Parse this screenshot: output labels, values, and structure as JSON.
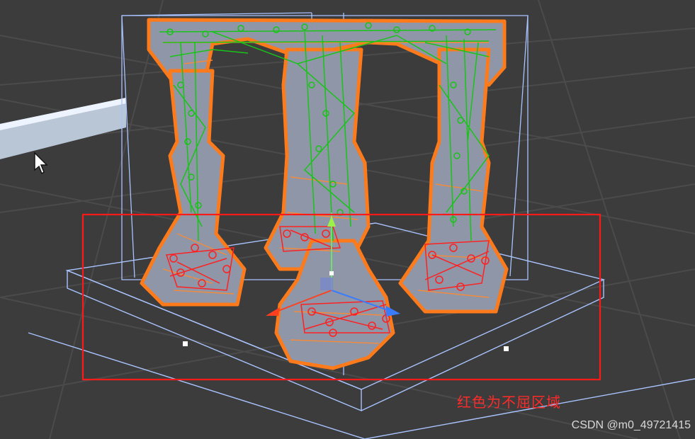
{
  "viewport": {
    "annotation_text": "红色为不屈区域",
    "watermark_text": "CSDN @m0_49721415"
  },
  "colors": {
    "background": "#3c3c3c",
    "grid": "#4a4a4a",
    "bounds": "#a9c3ff",
    "pillar": "#8f96a8",
    "outline": "#ff7a1a",
    "cloth_constrained": "#18c418",
    "cloth_free": "#ff2020",
    "highlight_box": "#ff1a1a"
  },
  "icons": {
    "cursor": "mouse-cursor-icon",
    "move_gizmo": "move-gizmo-icon"
  }
}
